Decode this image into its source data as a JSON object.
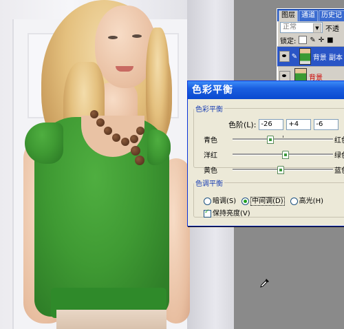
{
  "layers_panel": {
    "tabs": [
      "图层",
      "通道",
      "历史记"
    ],
    "blend_mode": "正常",
    "opacity_label": "不透",
    "lock_label": "锁定:",
    "layers": [
      {
        "name": "背景 副本",
        "selected": true
      },
      {
        "name": "背景",
        "selected": false
      }
    ]
  },
  "color_balance": {
    "title": "色彩平衡",
    "group_label": "色彩平衡",
    "levels_label": "色阶(L):",
    "levels": [
      "-26",
      "+4",
      "-6"
    ],
    "sliders": [
      {
        "left": "青色",
        "right": "红色",
        "value": -26
      },
      {
        "left": "洋红",
        "right": "绿色",
        "value": 4
      },
      {
        "left": "黄色",
        "right": "蓝色",
        "value": -6
      }
    ],
    "tone_group_label": "色调平衡",
    "tones": [
      {
        "label": "暗调(S)",
        "selected": false
      },
      {
        "label": "中间调(D)",
        "selected": true
      },
      {
        "label": "高光(H)",
        "selected": false
      }
    ],
    "preserve_label": "保持亮度(V)",
    "preserve_checked": true
  },
  "icons": {
    "eyedropper": "eyedropper-cursor-icon",
    "visibility": "eye-icon",
    "brush": "brush-icon"
  }
}
